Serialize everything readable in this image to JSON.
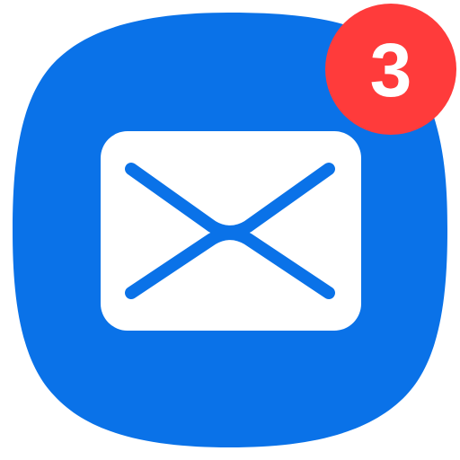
{
  "app": {
    "icon": "mail-envelope-icon",
    "colors": {
      "icon_background": "#0A72E8",
      "envelope_fill": "#FFFFFF",
      "envelope_stroke": "#0A72E8"
    }
  },
  "badge": {
    "count": "3",
    "color": "#FF3B3B",
    "text_color": "#FFFFFF"
  }
}
